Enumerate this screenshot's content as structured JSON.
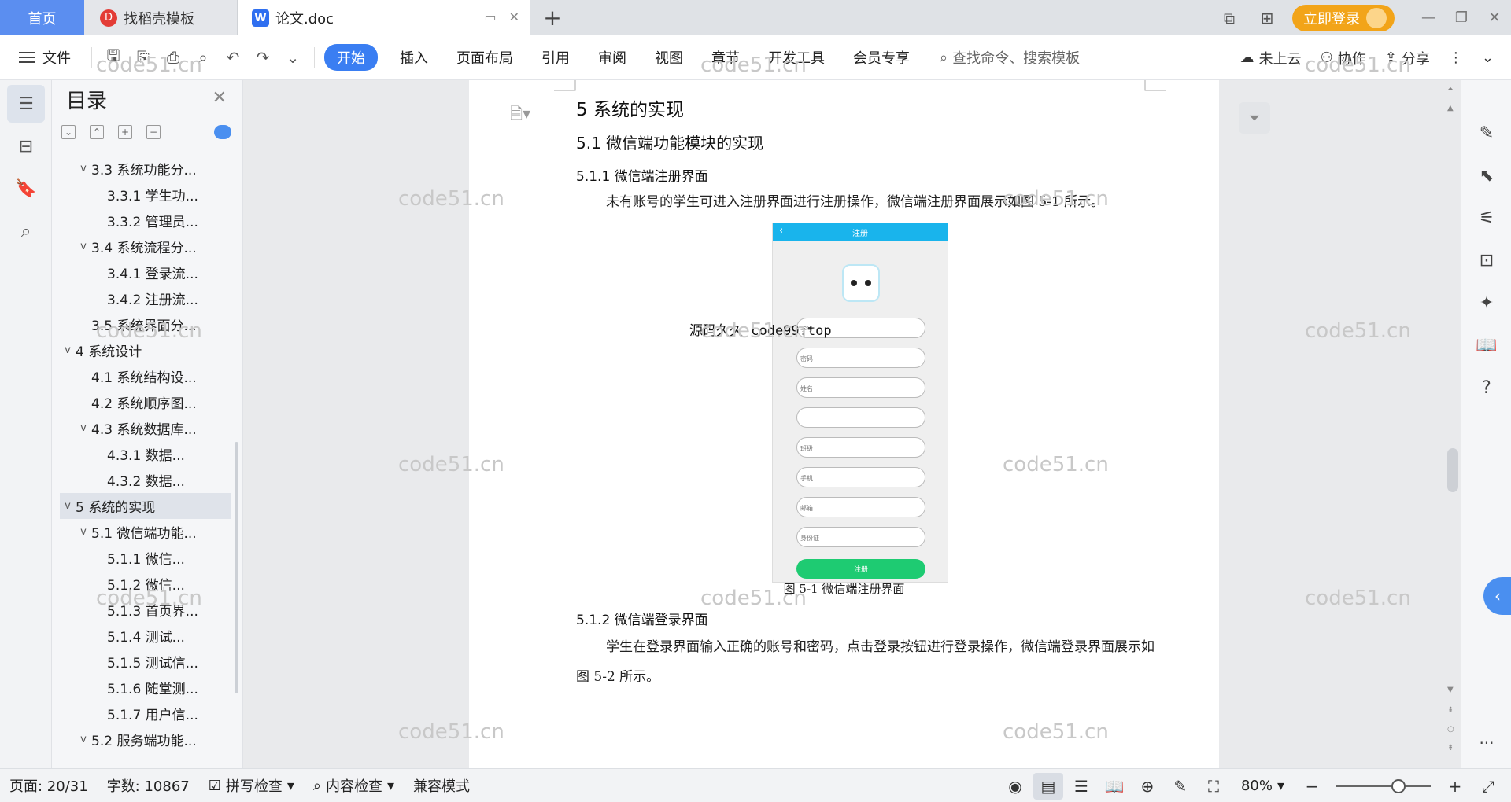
{
  "tabs": {
    "home": "首页",
    "daoke": "找稻壳模板",
    "doc": "论文.doc",
    "add": "+"
  },
  "tabbar_right": {
    "login": "立即登录"
  },
  "toolbar": {
    "file": "文件",
    "menus": [
      "开始",
      "插入",
      "页面布局",
      "引用",
      "审阅",
      "视图",
      "章节",
      "开发工具",
      "会员专享"
    ],
    "search_placeholder": "查找命令、搜索模板",
    "cloud": "未上云",
    "collab": "协作",
    "share": "分享"
  },
  "toc": {
    "title": "目录",
    "items": [
      {
        "label": "3.3  系统功能分...",
        "level": 2,
        "expand": "v"
      },
      {
        "label": "3.3.1 学生功...",
        "level": 3,
        "expand": ""
      },
      {
        "label": "3.3.2 管理员...",
        "level": 3,
        "expand": ""
      },
      {
        "label": "3.4  系统流程分...",
        "level": 2,
        "expand": "v"
      },
      {
        "label": "3.4.1 登录流...",
        "level": 3,
        "expand": ""
      },
      {
        "label": "3.4.2 注册流...",
        "level": 3,
        "expand": ""
      },
      {
        "label": "3.5  系统界面分...",
        "level": 2,
        "expand": ""
      },
      {
        "label": "4    系统设计",
        "level": 1,
        "expand": "v"
      },
      {
        "label": "4.1  系统结构设...",
        "level": 2,
        "expand": ""
      },
      {
        "label": "4.2  系统顺序图...",
        "level": 2,
        "expand": ""
      },
      {
        "label": "4.3  系统数据库...",
        "level": 2,
        "expand": "v"
      },
      {
        "label": "4.3.1  数据...",
        "level": 3,
        "expand": ""
      },
      {
        "label": "4.3.2  数据...",
        "level": 3,
        "expand": ""
      },
      {
        "label": "5    系统的实现",
        "level": 1,
        "expand": "v",
        "active": true
      },
      {
        "label": "5.1  微信端功能...",
        "level": 2,
        "expand": "v"
      },
      {
        "label": "5.1.1  微信...",
        "level": 3,
        "expand": ""
      },
      {
        "label": "5.1.2  微信...",
        "level": 3,
        "expand": ""
      },
      {
        "label": "5.1.3 首页界...",
        "level": 3,
        "expand": ""
      },
      {
        "label": "5.1.4  测试...",
        "level": 3,
        "expand": ""
      },
      {
        "label": "5.1.5 测试信...",
        "level": 3,
        "expand": ""
      },
      {
        "label": "5.1.6 随堂测...",
        "level": 3,
        "expand": ""
      },
      {
        "label": "5.1.7 用户信...",
        "level": 3,
        "expand": ""
      },
      {
        "label": "5.2  服务端功能...",
        "level": 2,
        "expand": "v"
      }
    ]
  },
  "document": {
    "h1": "5   系统的实现",
    "h2": "5.1  微信端功能模块的实现",
    "h3_a": "5.1.1 微信端注册界面",
    "para_a": "未有账号的学生可进入注册界面进行注册操作，微信端注册界面展示如图 5-1 所示。",
    "phone": {
      "title": "注册",
      "fields": [
        "学号",
        "密码",
        "姓名",
        "",
        "班级",
        "手机",
        "邮箱",
        "身份证"
      ],
      "button": "注册"
    },
    "overlay": "源码久久-code99.top",
    "caption": "图 5-1 微信端注册界面",
    "h3_b": "5.1.2 微信端登录界面",
    "para_b": "学生在登录界面输入正确的账号和密码，点击登录按钮进行登录操作，微信端登录界面展示如图 5-2 所示。"
  },
  "watermark": "code51.cn",
  "status": {
    "page": "页面: 20/31",
    "words": "字数: 10867",
    "spell": "拼写检查",
    "content": "内容检查",
    "compat": "兼容模式",
    "zoom": "80%"
  }
}
